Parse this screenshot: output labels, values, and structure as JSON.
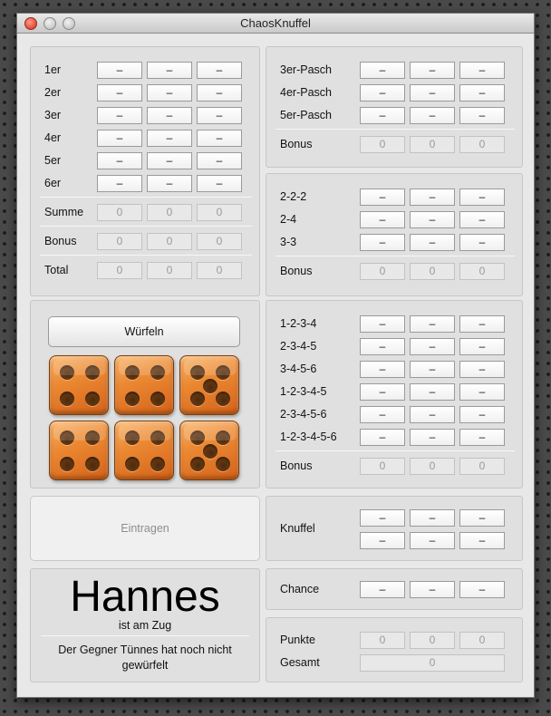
{
  "window": {
    "title": "ChaosKnuffel"
  },
  "upper": {
    "rows": [
      {
        "label": "1er",
        "values": [
          "–",
          "–",
          "–"
        ]
      },
      {
        "label": "2er",
        "values": [
          "–",
          "–",
          "–"
        ]
      },
      {
        "label": "3er",
        "values": [
          "–",
          "–",
          "–"
        ]
      },
      {
        "label": "4er",
        "values": [
          "–",
          "–",
          "–"
        ]
      },
      {
        "label": "5er",
        "values": [
          "–",
          "–",
          "–"
        ]
      },
      {
        "label": "6er",
        "values": [
          "–",
          "–",
          "–"
        ]
      }
    ],
    "summe": {
      "label": "Summe",
      "values": [
        "0",
        "0",
        "0"
      ]
    },
    "bonus": {
      "label": "Bonus",
      "values": [
        "0",
        "0",
        "0"
      ]
    },
    "total": {
      "label": "Total",
      "values": [
        "0",
        "0",
        "0"
      ]
    }
  },
  "pasch": {
    "rows": [
      {
        "label": "3er-Pasch",
        "values": [
          "–",
          "–",
          "–"
        ]
      },
      {
        "label": "4er-Pasch",
        "values": [
          "–",
          "–",
          "–"
        ]
      },
      {
        "label": "5er-Pasch",
        "values": [
          "–",
          "–",
          "–"
        ]
      }
    ],
    "bonus": {
      "label": "Bonus",
      "values": [
        "0",
        "0",
        "0"
      ]
    }
  },
  "pairs": {
    "rows": [
      {
        "label": "2-2-2",
        "values": [
          "–",
          "–",
          "–"
        ]
      },
      {
        "label": "2-4",
        "values": [
          "–",
          "–",
          "–"
        ]
      },
      {
        "label": "3-3",
        "values": [
          "–",
          "–",
          "–"
        ]
      }
    ],
    "bonus": {
      "label": "Bonus",
      "values": [
        "0",
        "0",
        "0"
      ]
    }
  },
  "straights": {
    "rows": [
      {
        "label": "1-2-3-4",
        "values": [
          "–",
          "–",
          "–"
        ]
      },
      {
        "label": "2-3-4-5",
        "values": [
          "–",
          "–",
          "–"
        ]
      },
      {
        "label": "3-4-5-6",
        "values": [
          "–",
          "–",
          "–"
        ]
      },
      {
        "label": "1-2-3-4-5",
        "values": [
          "–",
          "–",
          "–"
        ]
      },
      {
        "label": "2-3-4-5-6",
        "values": [
          "–",
          "–",
          "–"
        ]
      },
      {
        "label": "1-2-3-4-5-6",
        "values": [
          "–",
          "–",
          "–"
        ]
      }
    ],
    "bonus": {
      "label": "Bonus",
      "values": [
        "0",
        "0",
        "0"
      ]
    }
  },
  "knuffel": {
    "label": "Knuffel",
    "values": [
      "–",
      "–",
      "–",
      "–",
      "–",
      "–"
    ]
  },
  "chance": {
    "label": "Chance",
    "values": [
      "–",
      "–",
      "–"
    ]
  },
  "points": {
    "punkte_label": "Punkte",
    "punkte_values": [
      "0",
      "0",
      "0"
    ],
    "gesamt_label": "Gesamt",
    "gesamt_value": "0"
  },
  "controls": {
    "roll_label": "Würfeln",
    "enter_label": "Eintragen"
  },
  "dice": [
    4,
    4,
    5,
    4,
    4,
    5
  ],
  "status": {
    "player_name": "Hannes",
    "turn_text": "ist am Zug",
    "opponent_text": "Der Gegner Tünnes hat noch nicht gewürfelt"
  },
  "colors": {
    "die_face": "#ec8a34",
    "die_pip": "#5a3210",
    "background": "#4a4a4a"
  }
}
